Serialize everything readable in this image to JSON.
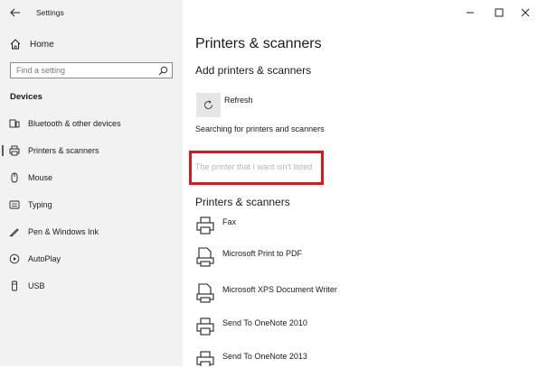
{
  "window": {
    "title": "Settings"
  },
  "sidebar": {
    "home_label": "Home",
    "search_placeholder": "Find a setting",
    "section_label": "Devices",
    "items": [
      {
        "label": "Bluetooth & other devices",
        "icon": "bluetooth-devices-icon",
        "selected": false
      },
      {
        "label": "Printers & scanners",
        "icon": "printer-icon",
        "selected": true
      },
      {
        "label": "Mouse",
        "icon": "mouse-icon",
        "selected": false
      },
      {
        "label": "Typing",
        "icon": "keyboard-icon",
        "selected": false
      },
      {
        "label": "Pen & Windows Ink",
        "icon": "pen-icon",
        "selected": false
      },
      {
        "label": "AutoPlay",
        "icon": "autoplay-icon",
        "selected": false
      },
      {
        "label": "USB",
        "icon": "usb-icon",
        "selected": false
      }
    ]
  },
  "main": {
    "title": "Printers & scanners",
    "add_heading": "Add printers & scanners",
    "refresh_label": "Refresh",
    "searching_text": "Searching for printers and scanners",
    "not_listed_link": "The printer that I want isn't listed",
    "list_heading": "Printers & scanners",
    "printers": [
      {
        "name": "Fax",
        "icon": "fax-printer-icon"
      },
      {
        "name": "Microsoft Print to PDF",
        "icon": "document-printer-icon"
      },
      {
        "name": "Microsoft XPS Document Writer",
        "icon": "document-printer-icon"
      },
      {
        "name": "Send To OneNote 2010",
        "icon": "printer-icon"
      },
      {
        "name": "Send To OneNote 2013",
        "icon": "printer-icon"
      }
    ]
  },
  "colors": {
    "sidebar_bg": "#f2f2f2",
    "highlight": "#e0141b",
    "disabled_text": "#b5b5b5"
  }
}
